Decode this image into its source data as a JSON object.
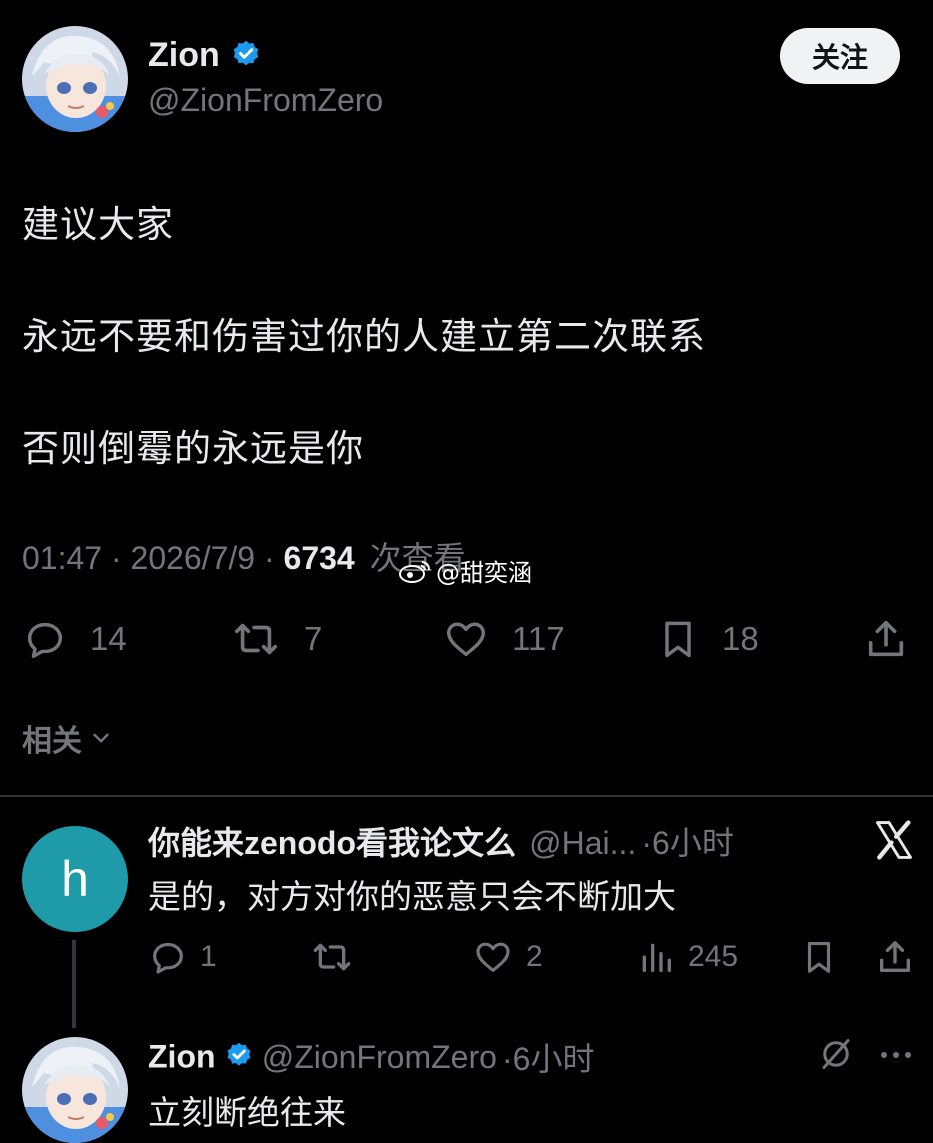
{
  "main_tweet": {
    "author_name": "Zion",
    "author_handle": "@ZionFromZero",
    "follow_label": "关注",
    "lines": [
      "建议大家",
      "永远不要和伤害过你的人建立第二次联系",
      "否则倒霉的永远是你"
    ],
    "time": "01:47",
    "date": "2026/7/9",
    "views": "6734",
    "views_label": "次查看",
    "sep": "·",
    "actions": {
      "replies": "14",
      "retweets": "7",
      "likes": "117",
      "bookmarks": "18"
    },
    "related_label": "相关"
  },
  "watermark": "@甜奕涵",
  "reply1": {
    "avatar_letter": "h",
    "author_name": "你能来zenodo看我论文么",
    "author_handle": "@Hai...",
    "time": "·6小时",
    "text": "是的，对方对你的恶意只会不断加大",
    "actions": {
      "replies": "1",
      "likes": "2",
      "views": "245"
    }
  },
  "reply2": {
    "author_name": "Zion",
    "author_handle": "@ZionFromZero",
    "time": "·6小时",
    "text": "立刻断绝往来"
  },
  "colors": {
    "background": "#000000",
    "text": "#e7e9ea",
    "muted": "#71767b",
    "verified": "#1d9bf0",
    "avatar_h": "#1e9aa8",
    "divider": "#2f3336"
  }
}
